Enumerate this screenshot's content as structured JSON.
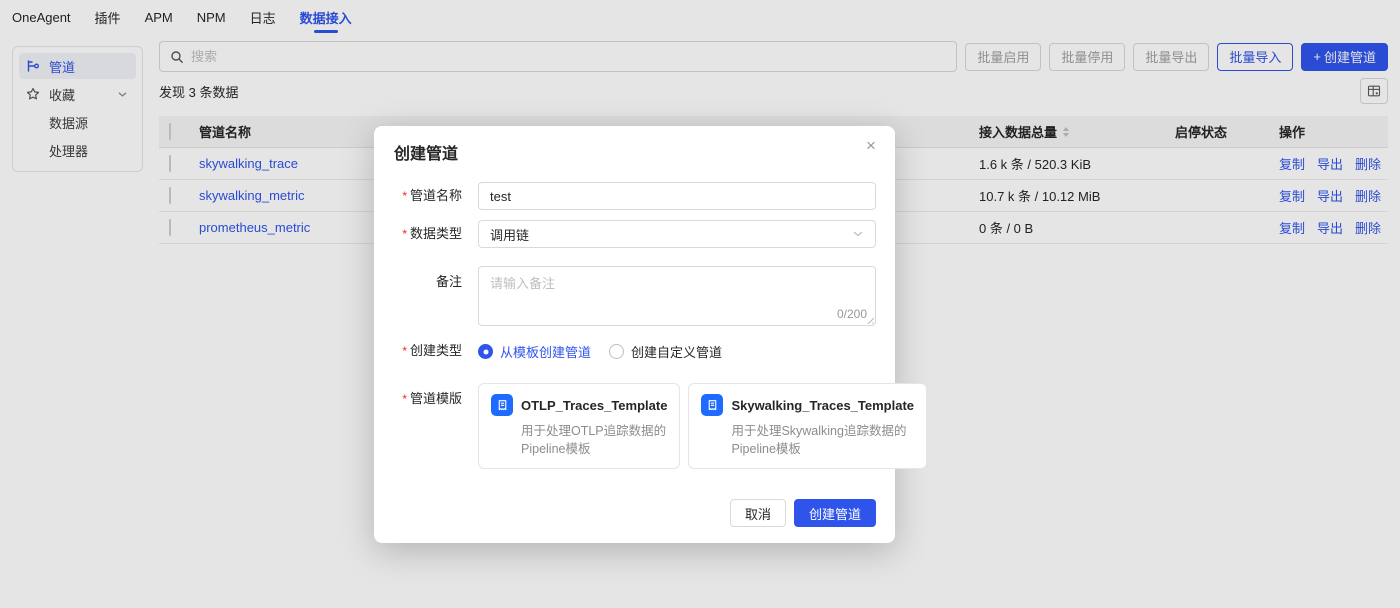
{
  "nav": {
    "items": [
      "OneAgent",
      "插件",
      "APM",
      "NPM",
      "日志",
      "数据接入"
    ],
    "active": "数据接入"
  },
  "sidebar": {
    "items": [
      {
        "label": "管道"
      },
      {
        "label": "收藏"
      },
      {
        "label": "数据源"
      },
      {
        "label": "处理器"
      }
    ]
  },
  "toolbar": {
    "search_placeholder": "搜索",
    "buttons": {
      "batch_enable": "批量启用",
      "batch_stop": "批量停用",
      "batch_export": "批量导出",
      "batch_import": "批量导入",
      "create_plus": "+",
      "create": "创建管道"
    }
  },
  "summary": {
    "text": "发现 3 条数据"
  },
  "table": {
    "columns": {
      "name": "管道名称",
      "total": "接入数据总量",
      "status": "启停状态",
      "actions": "操作"
    },
    "action_labels": {
      "copy": "复制",
      "export": "导出",
      "delete": "删除"
    },
    "rows": [
      {
        "name": "skywalking_trace",
        "total": "1.6 k 条 / 520.3 KiB",
        "enabled": true
      },
      {
        "name": "skywalking_metric",
        "total": "10.7 k 条 / 10.12 MiB",
        "enabled": true
      },
      {
        "name": "prometheus_metric",
        "total": "0 条 / 0 B",
        "enabled": false
      }
    ]
  },
  "modal": {
    "title": "创建管道",
    "close": "×",
    "required_mark": "*",
    "fields": {
      "name": {
        "label": "管道名称",
        "value": "test"
      },
      "data_type": {
        "label": "数据类型",
        "value": "调用链"
      },
      "remark": {
        "label": "备注",
        "placeholder": "请输入备注",
        "counter": "0/200"
      },
      "create_type": {
        "label": "创建类型",
        "options": [
          {
            "label": "从模板创建管道",
            "selected": true
          },
          {
            "label": "创建自定义管道",
            "selected": false
          }
        ]
      },
      "template": {
        "label": "管道模版",
        "cards": [
          {
            "title": "OTLP_Traces_Template",
            "desc": "用于处理OTLP追踪数据的Pipeline模板"
          },
          {
            "title": "Skywalking_Traces_Template",
            "desc": "用于处理Skywalking追踪数据的Pipeline模板"
          }
        ]
      }
    },
    "footer": {
      "cancel": "取消",
      "submit": "创建管道"
    }
  },
  "colors": {
    "accent": "#2f54eb",
    "template_icon_blue": "#1f6bff",
    "required_red": "#f5222d",
    "toggle_off_gray": "#c9c9c9"
  }
}
